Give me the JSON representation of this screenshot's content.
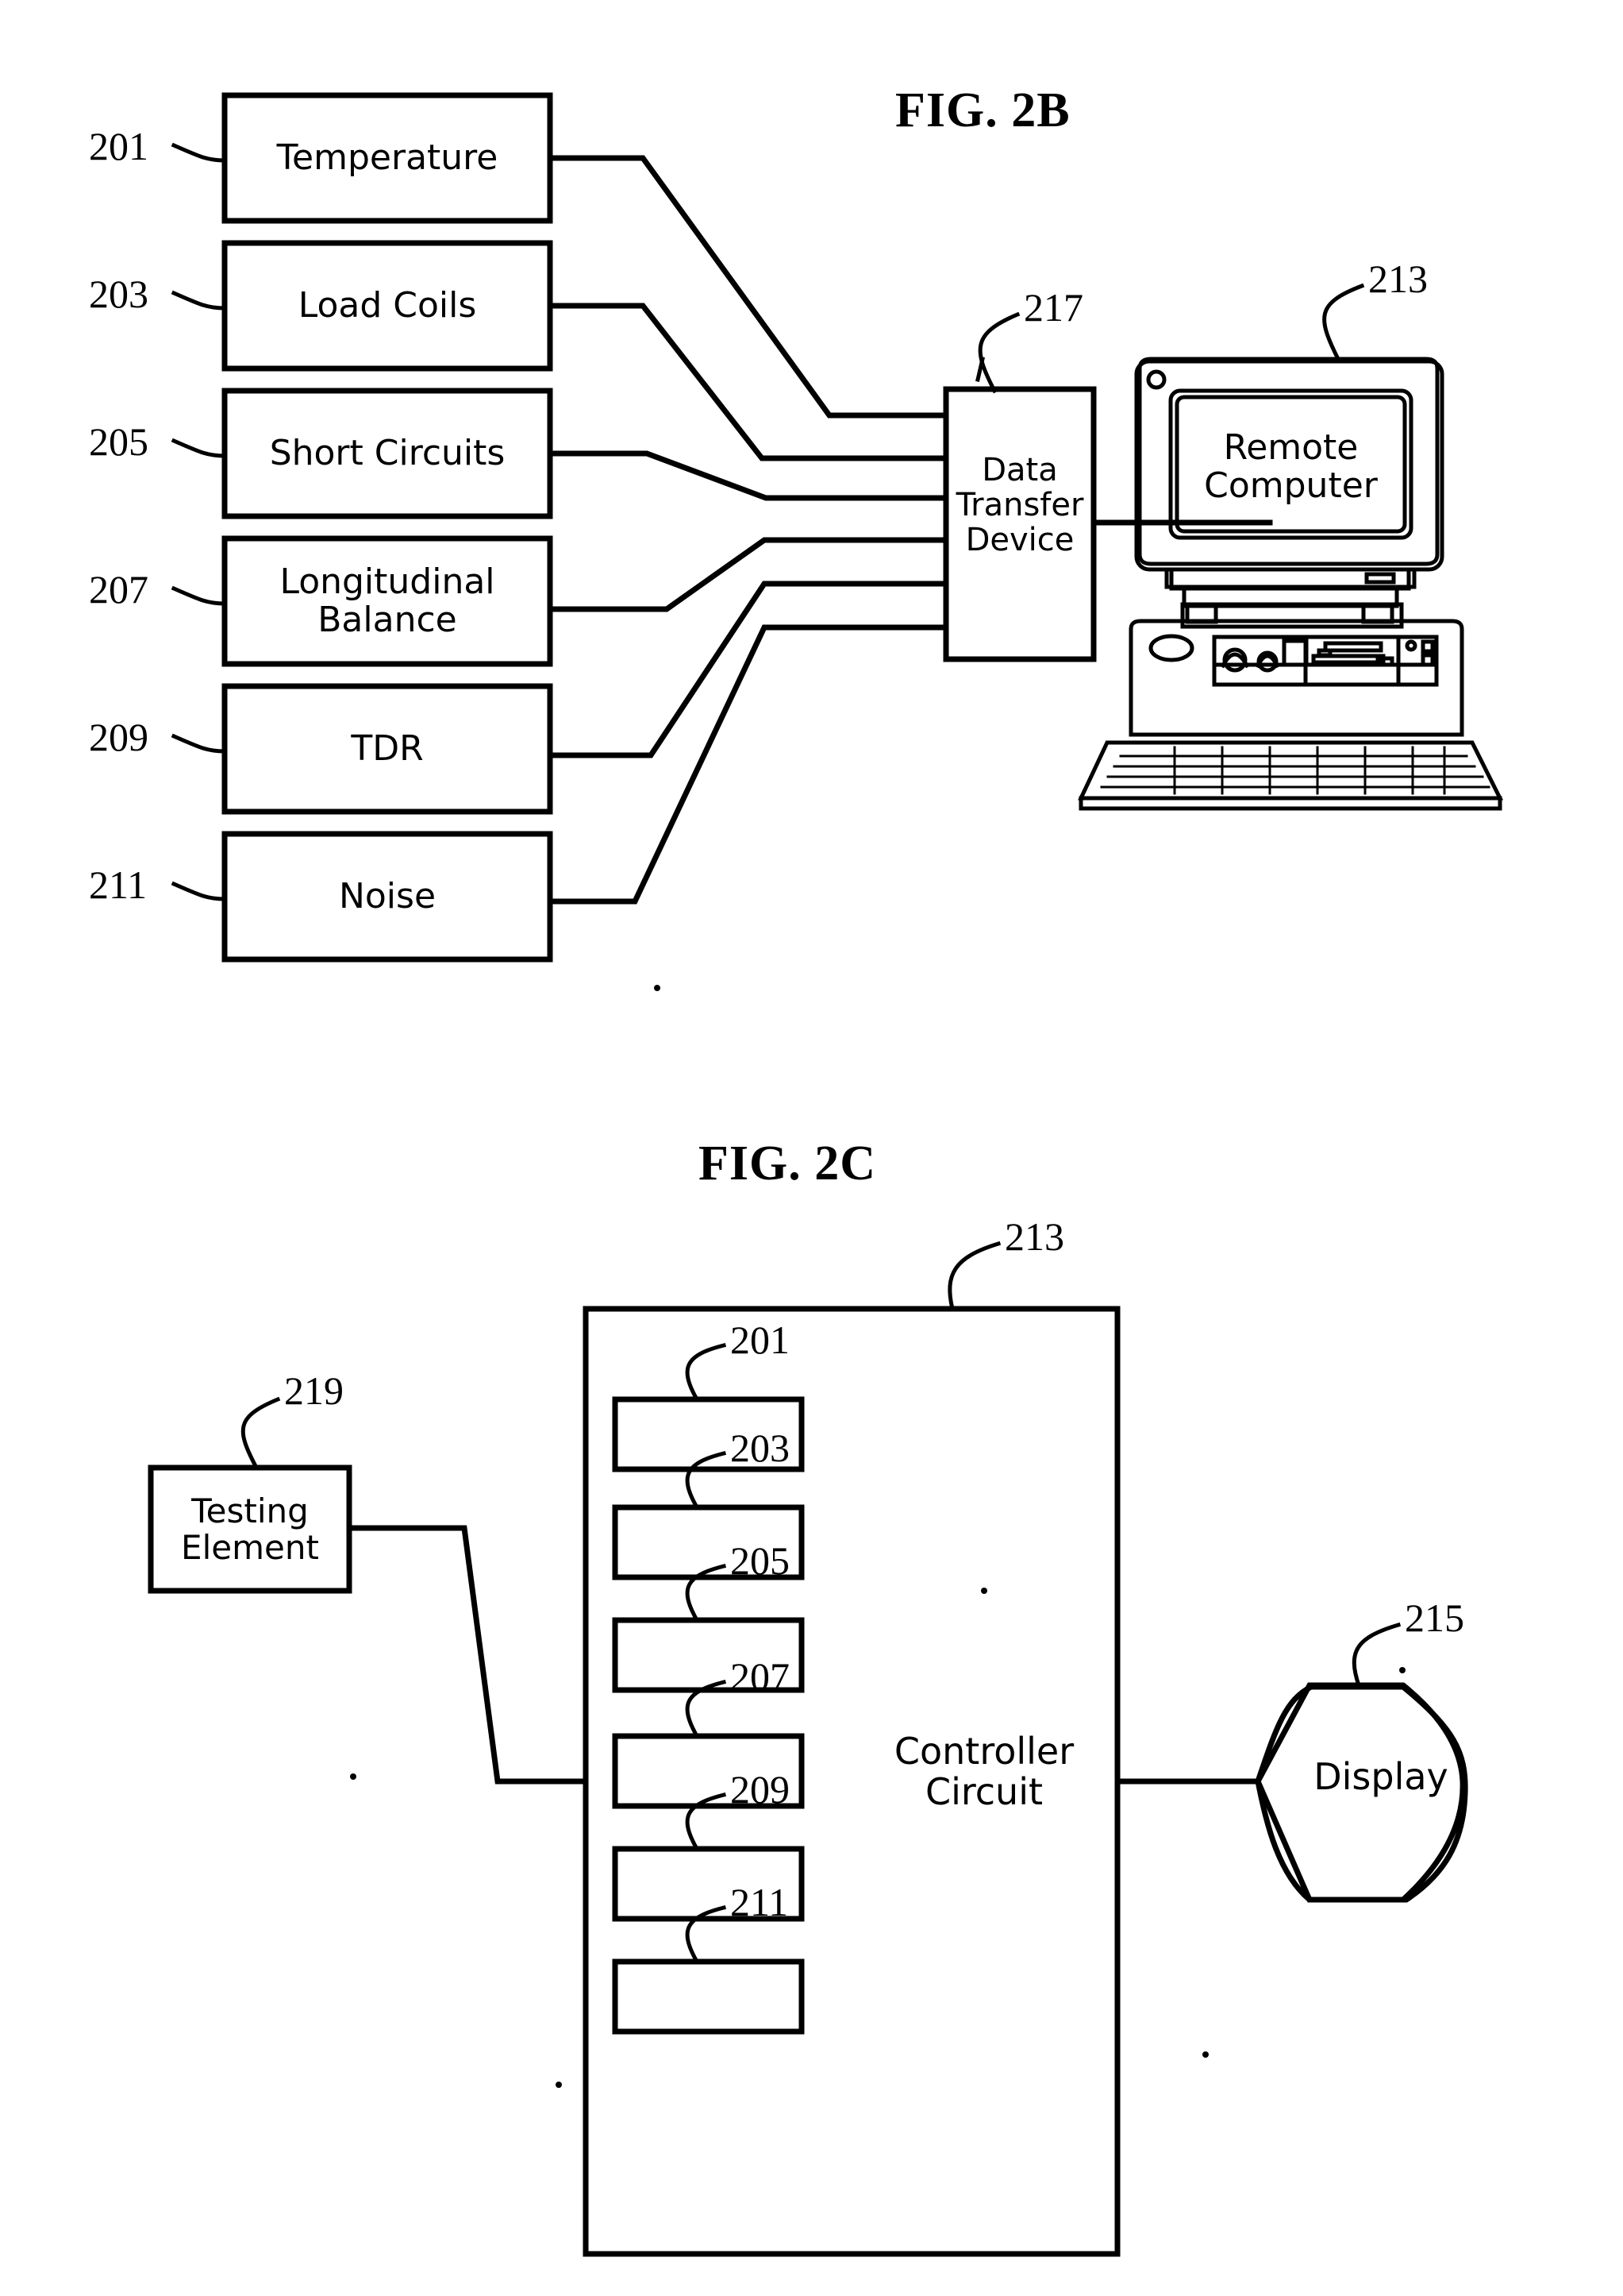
{
  "document": {
    "type": "patent-figure-sheet",
    "figures": [
      {
        "id": "fig2b",
        "title": "FIG. 2B"
      },
      {
        "id": "fig2c",
        "title": "FIG. 2C"
      }
    ]
  },
  "fig2b": {
    "title": "FIG. 2B",
    "test_blocks": [
      {
        "ref": "201",
        "label": "Temperature"
      },
      {
        "ref": "203",
        "label": "Load Coils"
      },
      {
        "ref": "205",
        "label": "Short Circuits"
      },
      {
        "ref": "207",
        "label": "Longitudinal\nBalance"
      },
      {
        "ref": "209",
        "label": "TDR"
      },
      {
        "ref": "211",
        "label": "Noise"
      }
    ],
    "data_transfer_device": {
      "ref": "217",
      "label": "Data\nTransfer\nDevice"
    },
    "remote_computer": {
      "ref": "213",
      "label": "Remote\nComputer"
    }
  },
  "fig2c": {
    "title": "FIG. 2C",
    "testing_element": {
      "ref": "219",
      "label": "Testing\nElement"
    },
    "controller_circuit": {
      "ref": "213",
      "label": "Controller\nCircuit"
    },
    "display": {
      "ref": "215",
      "label": "Display"
    },
    "inner_blocks": [
      {
        "ref": "201"
      },
      {
        "ref": "203"
      },
      {
        "ref": "205"
      },
      {
        "ref": "207"
      },
      {
        "ref": "209"
      },
      {
        "ref": "211"
      }
    ]
  },
  "colors": {
    "ink": "#000000",
    "paper": "#ffffff"
  }
}
